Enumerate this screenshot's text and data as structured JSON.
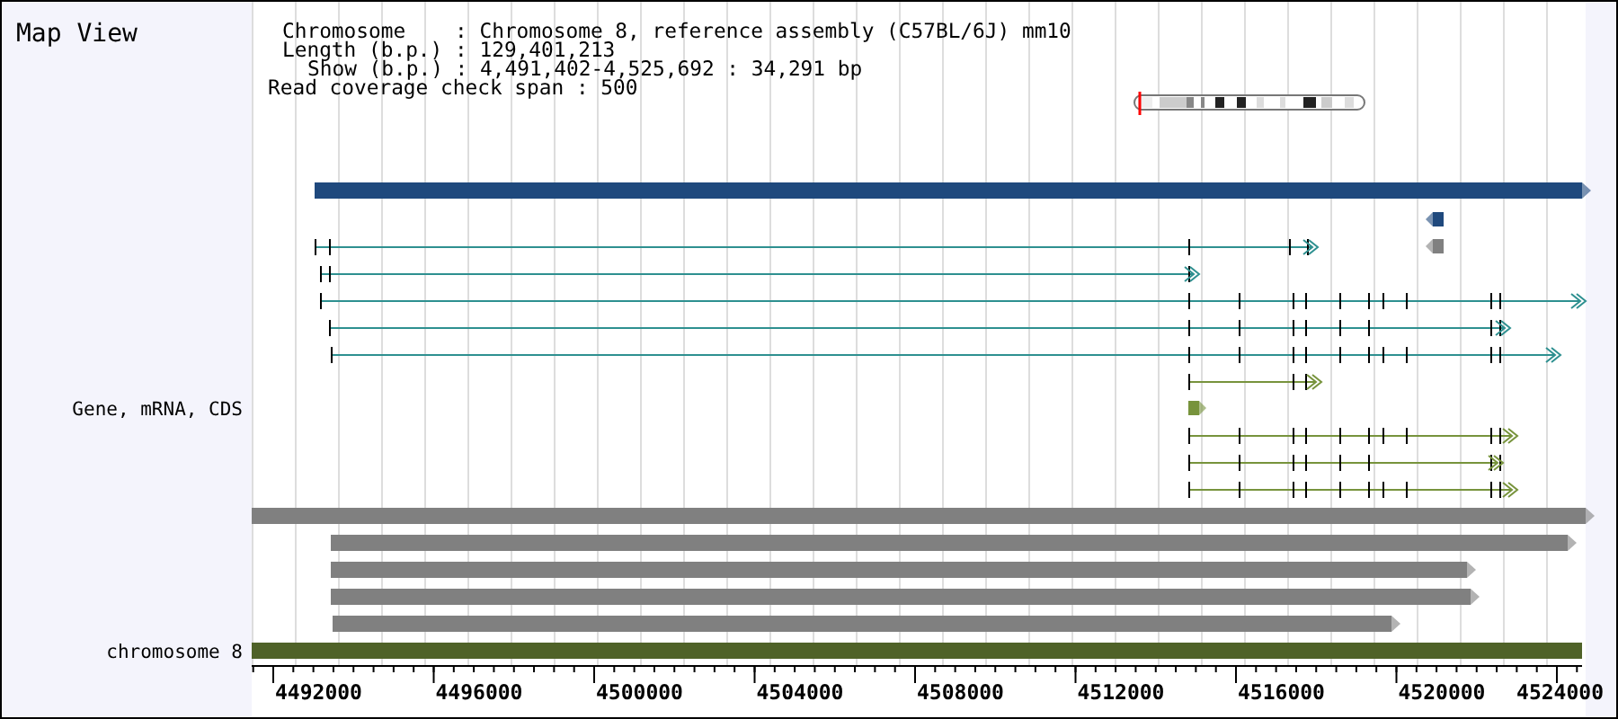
{
  "title": "Map View",
  "header": [
    "Chromosome    : Chromosome 8, reference assembly (C57BL/6J) mm10",
    "Length (b.p.) : 129,401,213",
    "Show (b.p.) : 4,491,402-4,525,692 : 34,291 bp",
    "Read coverage check span : 500"
  ],
  "track_labels": [
    "Gene, mRNA, CDS",
    "chromosome 8"
  ],
  "tracks": [
    {
      "kind": "bar",
      "color": "#1f497d"
    },
    {
      "kind": "marker",
      "color": "#1f497d"
    },
    {
      "kind": "marker",
      "color": "#808080"
    },
    {
      "kind": "transcript",
      "color": "#2e9090"
    },
    {
      "kind": "transcript",
      "color": "#2e9090"
    },
    {
      "kind": "transcript",
      "color": "#2e9090"
    },
    {
      "kind": "transcript",
      "color": "#2e9090"
    },
    {
      "kind": "transcript",
      "color": "#2e9090"
    },
    {
      "kind": "transcript",
      "color": "#77933c"
    },
    {
      "kind": "marker",
      "color": "#77933c"
    },
    {
      "kind": "transcript",
      "color": "#77933c"
    },
    {
      "kind": "transcript",
      "color": "#77933c"
    },
    {
      "kind": "transcript",
      "color": "#77933c"
    },
    {
      "kind": "bar",
      "color": "#808080"
    },
    {
      "kind": "bar",
      "color": "#808080"
    },
    {
      "kind": "bar",
      "color": "#808080"
    },
    {
      "kind": "bar",
      "color": "#808080"
    },
    {
      "kind": "bar",
      "color": "#808080"
    },
    {
      "kind": "bar",
      "color": "#4f6228"
    }
  ],
  "axis_labels": [
    "4492000",
    "4496000",
    "4500000",
    "4504000",
    "4508000",
    "4512000",
    "4516000",
    "4520000",
    "4524000"
  ]
}
